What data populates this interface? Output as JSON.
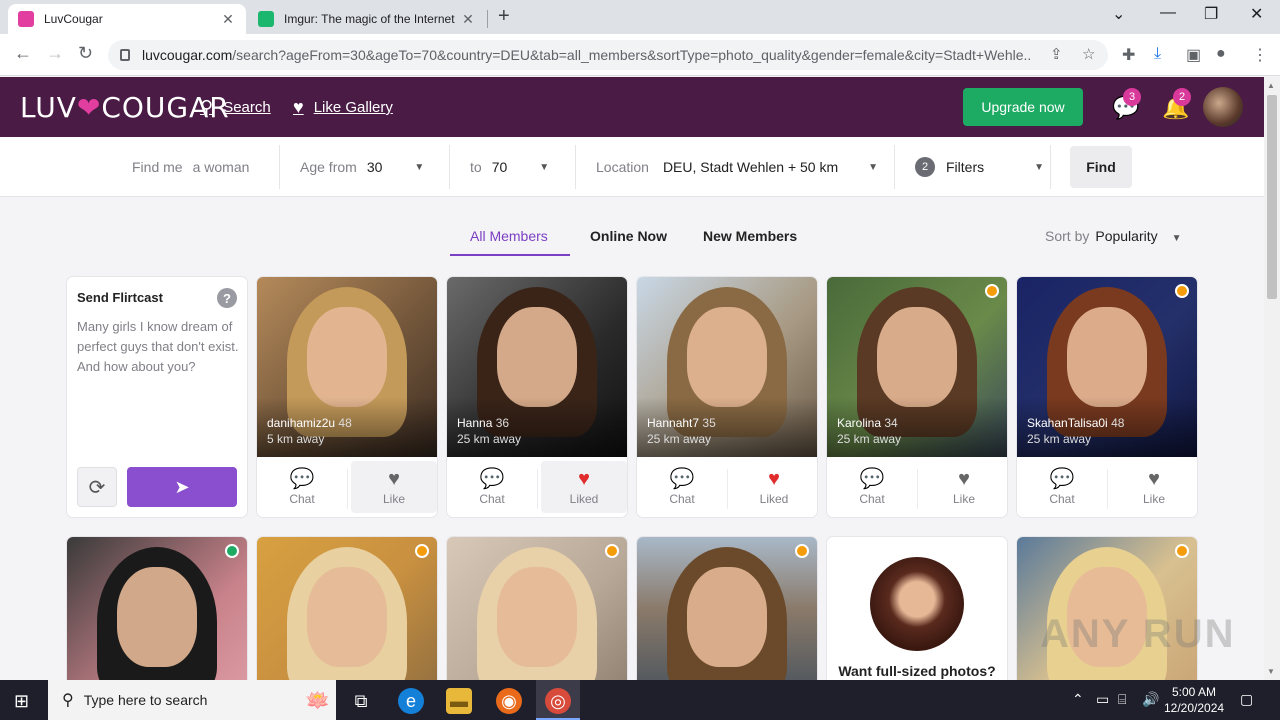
{
  "browser": {
    "tabs": [
      {
        "title": "LuvCougar",
        "active": true
      },
      {
        "title": "Imgur: The magic of the Internet",
        "active": false
      }
    ],
    "close_glyph": "✕",
    "new_tab_glyph": "+",
    "url_host": "luvcougar.com",
    "url_path": "/search?ageFrom=30&ageTo=70&country=DEU&tab=all_members&sortType=photo_quality&gender=female&city=Stadt+Wehle..."
  },
  "header": {
    "logo_left": "LUV",
    "logo_heart": "❤",
    "logo_right": "COUGAR",
    "search_label": "Search",
    "like_gallery_label": "Like Gallery",
    "upgrade_label": "Upgrade now",
    "messages_badge": "3",
    "notifications_badge": "2"
  },
  "filters": {
    "find_me_label": "Find me",
    "find_me_value": "a woman",
    "age_from_label": "Age from",
    "age_from_value": "30",
    "age_to_label": "to",
    "age_to_value": "70",
    "location_label": "Location",
    "location_value": "DEU, Stadt Wehlen + 50 km",
    "filters_count": "2",
    "filters_label": "Filters",
    "find_label": "Find"
  },
  "member_tabs": [
    "All Members",
    "Online Now",
    "New Members"
  ],
  "sort": {
    "label": "Sort by",
    "value": "Popularity"
  },
  "flirtcast": {
    "title": "Send Flirtcast",
    "help": "?",
    "text": "Many girls I know dream of perfect guys that don't exist. And how about you?"
  },
  "actions": {
    "chat": "Chat",
    "like": "Like",
    "liked": "Liked"
  },
  "profiles": [
    {
      "name": "danihamiz2u",
      "age": "48",
      "distance": "5 km away",
      "liked": false,
      "status": "none"
    },
    {
      "name": "Hanna",
      "age": "36",
      "distance": "25 km away",
      "liked": true,
      "status": "none"
    },
    {
      "name": "Hannaht7",
      "age": "35",
      "distance": "25 km away",
      "liked": true,
      "status": "none"
    },
    {
      "name": "Karolina",
      "age": "34",
      "distance": "25 km away",
      "liked": false,
      "status": "away"
    },
    {
      "name": "SkahanTalisa0i",
      "age": "48",
      "distance": "25 km away",
      "liked": false,
      "status": "away"
    }
  ],
  "promo_text": "Want full-sized photos?",
  "watermark": "ANY RUN",
  "taskbar": {
    "search_placeholder": "Type here to search",
    "time": "5:00 AM",
    "date": "12/20/2024"
  },
  "colors": {
    "brand": "#4a1b45",
    "accent": "#7b3fc4",
    "upgrade": "#1daa63",
    "liked": "#e02c2c",
    "away": "#f59c0a",
    "online": "#1daa63"
  }
}
